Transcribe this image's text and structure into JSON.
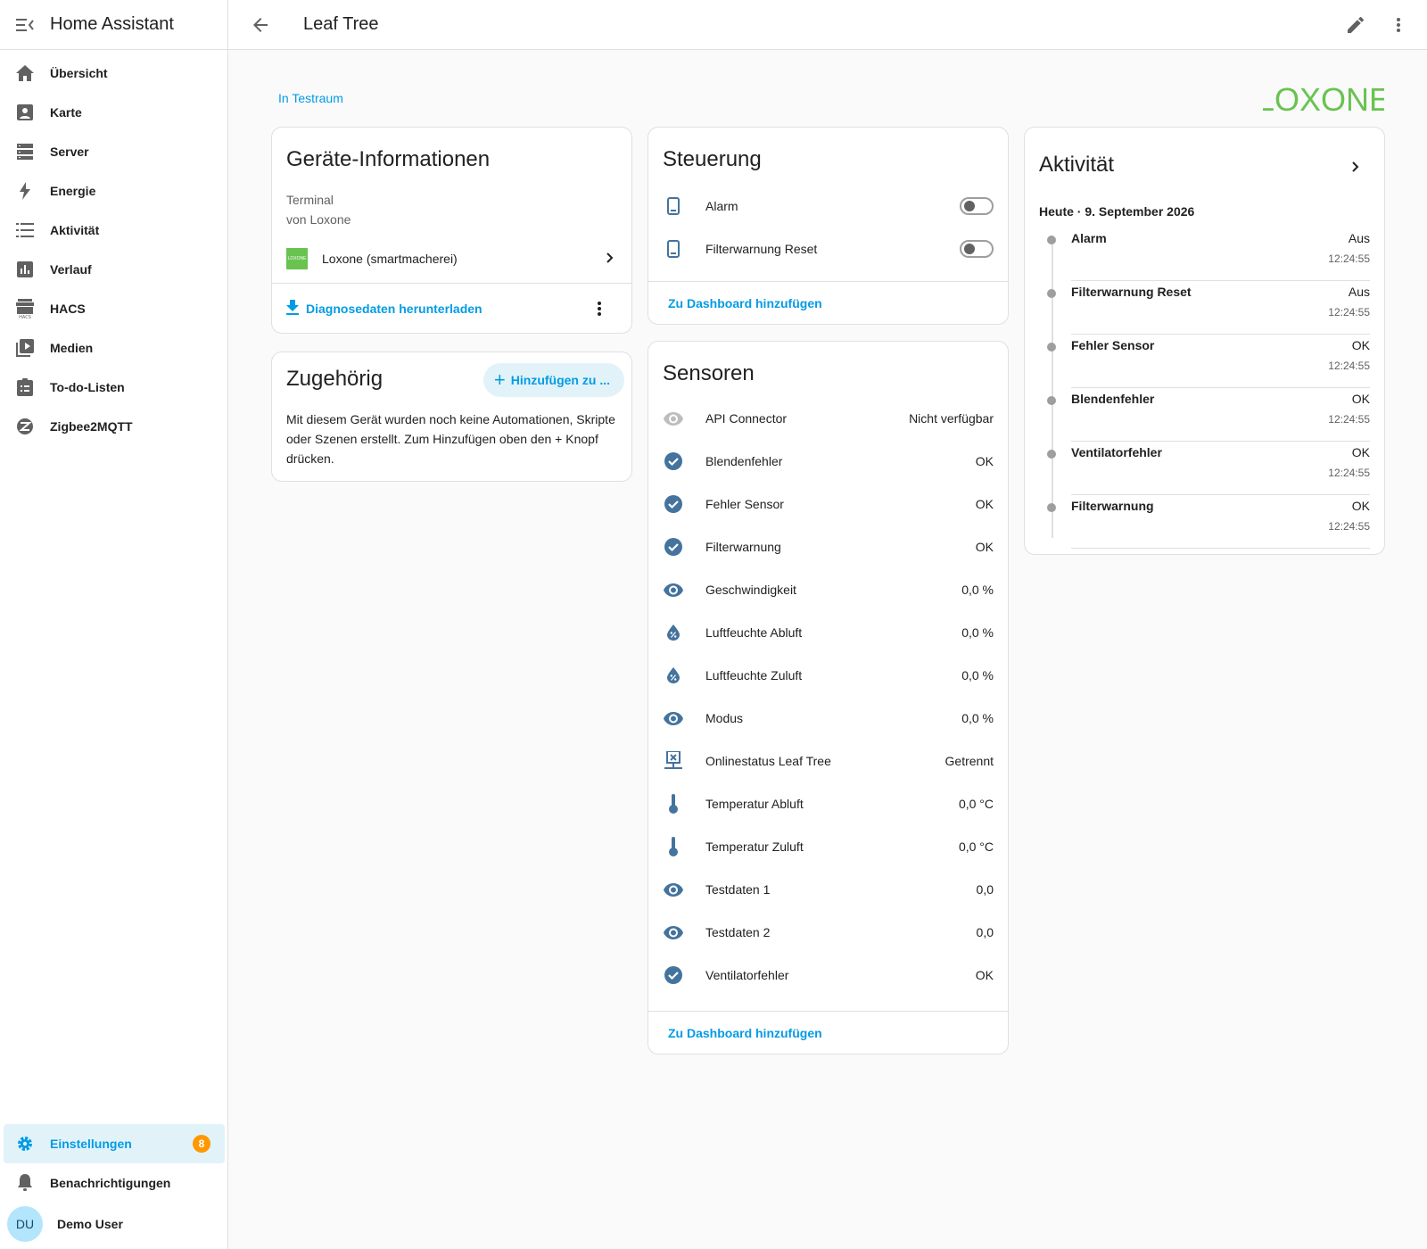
{
  "sidebar": {
    "title": "Home Assistant",
    "items": [
      {
        "label": "Übersicht",
        "icon": "home-icon"
      },
      {
        "label": "Karte",
        "icon": "map-icon"
      },
      {
        "label": "Server",
        "icon": "server-icon"
      },
      {
        "label": "Energie",
        "icon": "lightning-icon"
      },
      {
        "label": "Aktivität",
        "icon": "activity-list-icon"
      },
      {
        "label": "Verlauf",
        "icon": "chart-icon"
      },
      {
        "label": "HACS",
        "icon": "hacs-icon"
      },
      {
        "label": "Medien",
        "icon": "media-icon"
      },
      {
        "label": "To-do-Listen",
        "icon": "clipboard-icon"
      },
      {
        "label": "Zigbee2MQTT",
        "icon": "zigbee-icon"
      }
    ],
    "settings": {
      "label": "Einstellungen",
      "badge": "8"
    },
    "notifications": {
      "label": "Benachrichtigungen"
    },
    "user": {
      "initials": "DU",
      "name": "Demo User"
    }
  },
  "topbar": {
    "title": "Leaf Tree"
  },
  "area": {
    "label": "In Testraum"
  },
  "brand": {
    "logo_text": "LOXONE",
    "color": "#69c350"
  },
  "device_info": {
    "title": "Geräte-Informationen",
    "model": "Terminal",
    "manufacturer": "von Loxone",
    "integration_logo": "LOXONE",
    "integration": "Loxone (smartmacherei)",
    "download": "Diagnosedaten herunterladen"
  },
  "related": {
    "title": "Zugehörig",
    "add_button": "Hinzufügen zu ...",
    "text": "Mit diesem Gerät wurden noch keine Automationen, Skripte oder Szenen erstellt. Zum Hinzufügen oben den + Knopf drücken."
  },
  "controls": {
    "title": "Steuerung",
    "items": [
      {
        "name": "Alarm",
        "icon": "tablet-icon",
        "state": "off"
      },
      {
        "name": "Filterwarnung Reset",
        "icon": "tablet-icon",
        "state": "off"
      }
    ],
    "dashboard_link": "Zu Dashboard hinzufügen"
  },
  "sensors": {
    "title": "Sensoren",
    "items": [
      {
        "name": "API Connector",
        "value": "Nicht verfügbar",
        "icon": "eye-icon"
      },
      {
        "name": "Blendenfehler",
        "value": "OK",
        "icon": "check-circle-icon"
      },
      {
        "name": "Fehler Sensor",
        "value": "OK",
        "icon": "check-circle-icon"
      },
      {
        "name": "Filterwarnung",
        "value": "OK",
        "icon": "check-circle-icon"
      },
      {
        "name": "Geschwindigkeit",
        "value": "0,0 %",
        "icon": "eye-icon"
      },
      {
        "name": "Luftfeuchte Abluft",
        "value": "0,0 %",
        "icon": "humidity-icon"
      },
      {
        "name": "Luftfeuchte Zuluft",
        "value": "0,0 %",
        "icon": "humidity-icon"
      },
      {
        "name": "Modus",
        "value": "0,0 %",
        "icon": "eye-icon"
      },
      {
        "name": "Onlinestatus Leaf Tree",
        "value": "Getrennt",
        "icon": "network-off-icon"
      },
      {
        "name": "Temperatur Abluft",
        "value": "0,0 °C",
        "icon": "thermometer-icon"
      },
      {
        "name": "Temperatur Zuluft",
        "value": "0,0 °C",
        "icon": "thermometer-icon"
      },
      {
        "name": "Testdaten 1",
        "value": "0,0",
        "icon": "eye-icon"
      },
      {
        "name": "Testdaten 2",
        "value": "0,0",
        "icon": "eye-icon"
      },
      {
        "name": "Ventilatorfehler",
        "value": "OK",
        "icon": "check-circle-icon"
      }
    ],
    "dashboard_link": "Zu Dashboard hinzufügen"
  },
  "activity": {
    "title": "Aktivität",
    "date": "Heute · 9. September 2026",
    "items": [
      {
        "name": "Alarm",
        "state": "Aus",
        "time": "12:24:55"
      },
      {
        "name": "Filterwarnung Reset",
        "state": "Aus",
        "time": "12:24:55"
      },
      {
        "name": "Fehler Sensor",
        "state": "OK",
        "time": "12:24:55"
      },
      {
        "name": "Blendenfehler",
        "state": "OK",
        "time": "12:24:55"
      },
      {
        "name": "Ventilatorfehler",
        "state": "OK",
        "time": "12:24:55"
      },
      {
        "name": "Filterwarnung",
        "state": "OK",
        "time": "12:24:55"
      }
    ]
  },
  "colors": {
    "accent": "#039be5",
    "icon": "#44739e",
    "badge": "#ff9800",
    "text": "#212121"
  }
}
